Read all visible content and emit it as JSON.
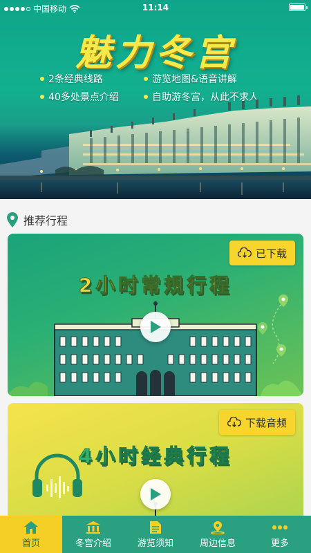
{
  "status_bar": {
    "carrier": "中国移动",
    "time": "11:14"
  },
  "hero": {
    "title": "魅力冬宫",
    "features": [
      "2条经典线路",
      "游览地图&语音讲解",
      "40多处景点介绍",
      "自助游冬宫，从此不求人"
    ]
  },
  "section": {
    "title": "推荐行程",
    "icon": "location-pin-icon"
  },
  "itineraries": [
    {
      "title": "2小时常规行程",
      "download_label": "已下载",
      "download_icon": "cloud-download-icon"
    },
    {
      "title": "4小时经典行程",
      "download_label": "下载音频",
      "download_icon": "cloud-download-icon"
    }
  ],
  "tabbar": {
    "active": "首页",
    "items": [
      {
        "label": "首页",
        "icon": "home-icon"
      },
      {
        "label": "冬宫介绍",
        "icon": "museum-icon"
      },
      {
        "label": "游览须知",
        "icon": "document-icon"
      },
      {
        "label": "周边信息",
        "icon": "map-pin-icon"
      },
      {
        "label": "更多",
        "icon": "more-icon"
      }
    ]
  },
  "colors": {
    "brand_green": "#2aa080",
    "accent_yellow": "#f5cf26",
    "title_yellow": "#f6e94a"
  }
}
